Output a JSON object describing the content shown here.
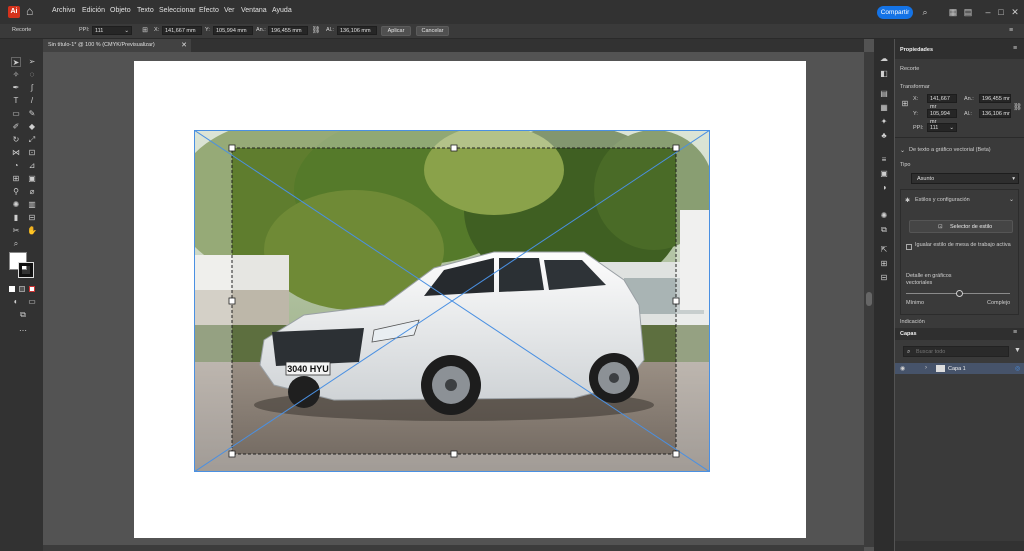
{
  "menubar": {
    "items": [
      "Archivo",
      "Edición",
      "Objeto",
      "Texto",
      "Seleccionar",
      "Efecto",
      "Ver",
      "Ventana",
      "Ayuda"
    ],
    "share_label": "Compartir",
    "app_logo": "Ai"
  },
  "control_bar": {
    "mode": "Recorte",
    "ppi_label": "PPI:",
    "ppi_value": "111",
    "x_label": "X:",
    "x_value": "141,667 mm",
    "y_label": "Y:",
    "y_value": "105,994 mm",
    "w_label": "An.:",
    "w_value": "196,455 mm",
    "h_label": "Al.:",
    "h_value": "136,106 mm",
    "apply_label": "Aplicar",
    "cancel_label": "Cancelar"
  },
  "document_tab": {
    "title": "Sin título-1* @ 100 % (CMYK/Previsualizar)"
  },
  "photo": {
    "plate": "3040 HYU"
  },
  "properties": {
    "tab_title": "Propiedades",
    "section_label": "Recorte",
    "transform_label": "Transformar",
    "x_label": "X:",
    "x_value": "141,667 mr",
    "y_label": "Y:",
    "y_value": "105,994 mr",
    "w_label": "An.:",
    "w_value": "196,455 mr",
    "h_label": "Al.:",
    "h_value": "136,106 mr",
    "ppi_label": "PPI:",
    "ppi_value": "111",
    "vector_section": "De texto a gráfico vectorial (Beta)",
    "type_label": "Tipo",
    "type_value": "Asunto",
    "styles_label": "Estilos y configuración",
    "style_selector_label": "Selector de estilo",
    "match_style_label": "Igualar estilo de mesa de trabajo activa",
    "detail_label": "Detalle en gráficos vectoriales",
    "min_label": "Mínimo",
    "max_label": "Complejo",
    "indicacion_label": "Indicación"
  },
  "layers": {
    "tab_title": "Capas",
    "search_placeholder": "Buscar todo",
    "layer_name": "Capa 1"
  },
  "colors": {
    "accent": "#1473e6",
    "selection": "#4a90e2",
    "chrome_dark": "#323232",
    "panel": "#3a3a3a",
    "canvas": "#535353"
  }
}
